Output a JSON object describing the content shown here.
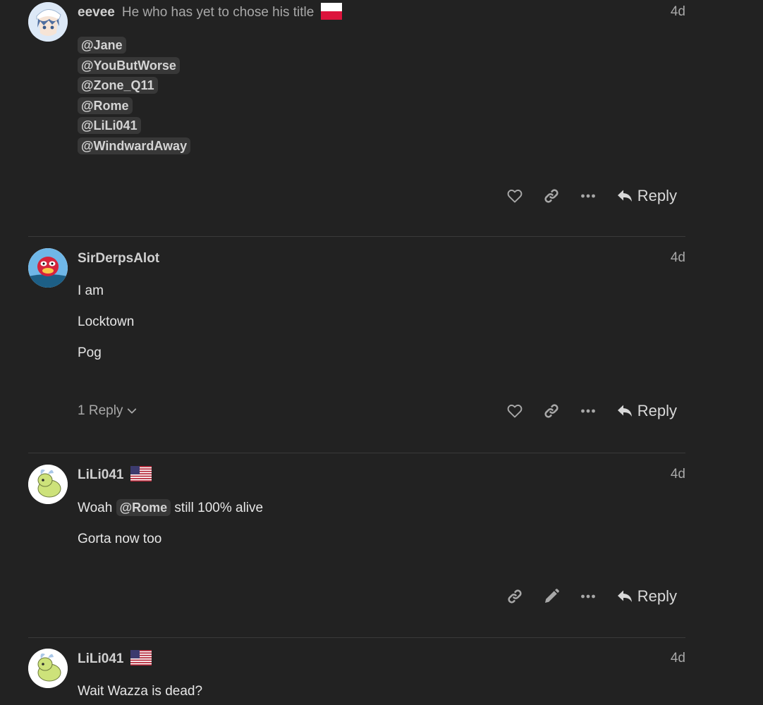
{
  "posts": [
    {
      "username": "eevee",
      "user_title": "He who has yet to chose his title",
      "flag": "poland-flag",
      "date": "4d",
      "mentions": [
        "@Jane",
        "@YouButWorse",
        "@Zone_Q11",
        "@Rome",
        "@LiLi041",
        "@WindwardAway"
      ],
      "reply_label": "Reply"
    },
    {
      "username": "SirDerpsAlot",
      "date": "4d",
      "paragraphs": [
        "I am",
        "Locktown",
        "Pog"
      ],
      "replies_toggle": "1 Reply",
      "reply_label": "Reply"
    },
    {
      "username": "LiLi041",
      "flag": "usa-flag",
      "date": "4d",
      "line1_prefix": "Woah",
      "line1_mention": "@Rome",
      "line1_suffix": "still 100% alive",
      "line2": "Gorta now too",
      "reply_label": "Reply"
    },
    {
      "username": "LiLi041",
      "flag": "usa-flag",
      "date": "4d",
      "line1": "Wait Wazza is dead?"
    }
  ],
  "colors": {
    "background": "#222222",
    "divider": "#3a3a3a",
    "mention_bg": "#383838"
  }
}
